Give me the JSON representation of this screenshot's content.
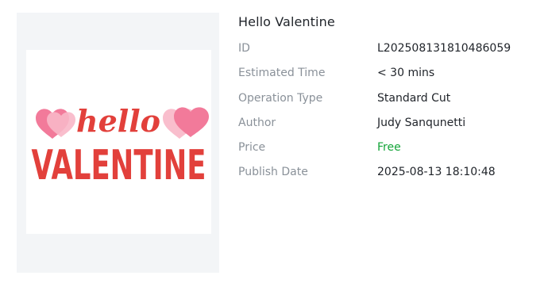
{
  "design": {
    "title": "Hello Valentine",
    "image_alt": "hello VALENTINE design with pink hearts",
    "artwork": {
      "script_word": "hello",
      "block_word": "VALENTINE",
      "colors": {
        "text": "#e2403b",
        "heart_dark": "#f27a9a",
        "heart_light": "#f8b7c8"
      }
    }
  },
  "details": [
    {
      "label": "ID",
      "value": "L202508131810486059"
    },
    {
      "label": "Estimated Time",
      "value": "< 30 mins"
    },
    {
      "label": "Operation Type",
      "value": "Standard Cut"
    },
    {
      "label": "Author",
      "value": "Judy Sanqunetti"
    },
    {
      "label": "Price",
      "value": "Free",
      "color": "#13a438"
    },
    {
      "label": "Publish Date",
      "value": "2025-08-13 18:10:48"
    }
  ],
  "colors": {
    "label": "#8a9199",
    "value": "#1f2329",
    "price_free": "#13a438",
    "panel_bg": "#f3f5f7"
  }
}
